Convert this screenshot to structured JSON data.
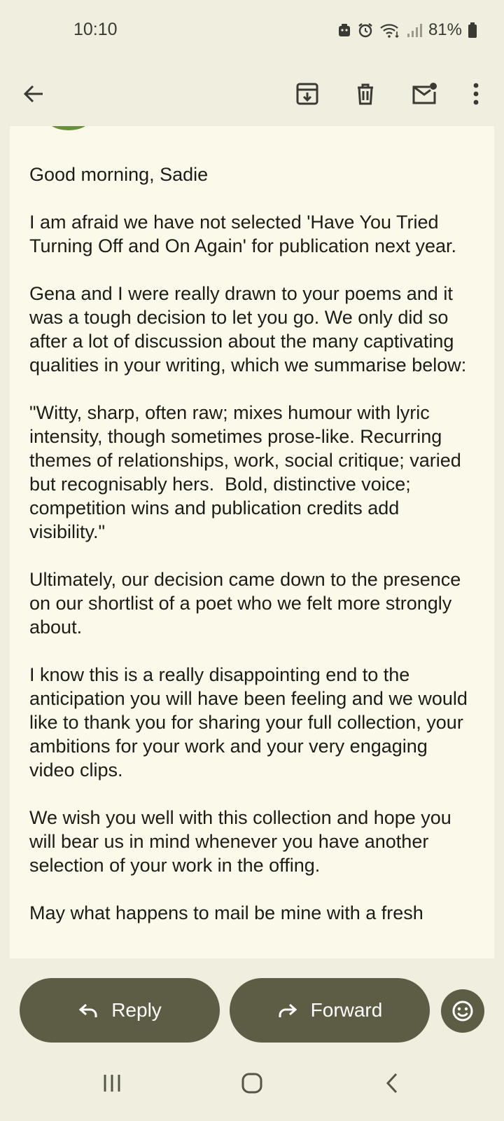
{
  "status_bar": {
    "time": "10:10",
    "battery_percent": "81%",
    "icons": [
      "android-icon",
      "alarm-icon",
      "wifi-icon",
      "signal-icon",
      "battery-icon"
    ]
  },
  "toolbar": {
    "back_icon": "arrow-back-icon",
    "archive_icon": "archive-icon",
    "delete_icon": "trash-icon",
    "mark_unread_icon": "mail-unread-icon",
    "more_icon": "more-vert-icon"
  },
  "email": {
    "paragraphs": [
      "Good morning, Sadie",
      "I am afraid we have not selected 'Have You Tried Turning Off and On Again' for publication next year.",
      "Gena and I were really drawn to your poems and it was a tough decision to let you go. We only did so after a lot of discussion about the many captivating qualities in your writing, which we summarise below:",
      "\"Witty, sharp, often raw; mixes humour with lyric intensity, though sometimes prose-like. Recurring themes of relationships, work, social critique; varied but recognisably hers.  Bold, distinctive voice; competition wins and publication credits add visibility.\"",
      "Ultimately, our decision came down to the presence on our shortlist of a poet who we felt more strongly about.",
      "I know this is a really disappointing end to the anticipation you will have been feeling and we would like to thank you for sharing your full collection, your ambitions for your work and your very engaging video clips.",
      "We wish you well with this collection and hope you will bear us in mind whenever you have another selection of your work in the offing.",
      "May what happens to mail be mine with a fresh"
    ]
  },
  "actions": {
    "reply_label": "Reply",
    "forward_label": "Forward",
    "emoji_icon": "emoji-smile-icon"
  },
  "colors": {
    "background": "#efeedf",
    "card": "#fbfaea",
    "pill": "#5d5d45"
  }
}
